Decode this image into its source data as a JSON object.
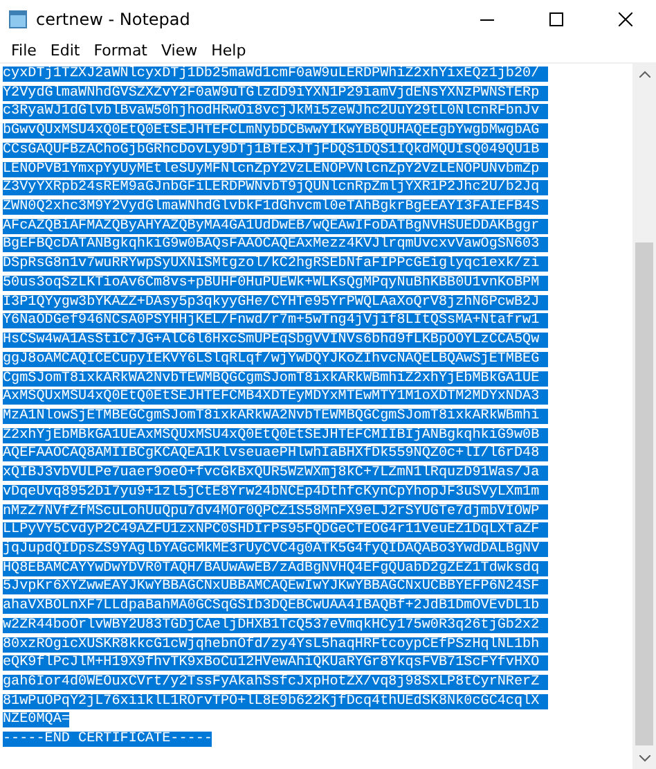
{
  "window": {
    "title": "certnew - Notepad"
  },
  "menu": [
    {
      "label": "File"
    },
    {
      "label": "Edit"
    },
    {
      "label": "Format"
    },
    {
      "label": "View"
    },
    {
      "label": "Help"
    }
  ],
  "document": {
    "selected": true,
    "lines": [
      "cyxDTj1TZXJ2aWNlcyxDTj1Db25maWd1cmF0aW9uLERDPWhiZ2xhYixEQz1jb20/",
      "Y2VydGlmaWNhdGVSZXZvY2F0aW9uTGlzdD9iYXN1P29iamVjdENsYXNzPWNSTERp",
      "c3RyaWJ1dGlvblBvaW50hjhodHRwOi8vcjJkMi5zeWJhc2UuY29tL0NlcnRFbnJv",
      "bGwvQUxMSU4xQ0EtQ0EtSEJHTEFCLmNybDCBwwYIKwYBBQUHAQEEgbYwgbMwgbAG",
      "CCsGAQUFBzAChoGjbGRhcDovLy9DTj1BTExJTjFDQS1DQS1IQkdMQUIsQ049QU1B",
      "LENOPVB1YmxpYyUyMEtleSUyMFNlcnZpY2VzLENOPVNlcnZpY2VzLENOPUNvbmZp",
      "Z3VyYXRpb24sREM9aGJnbGFiLERDPWNvbT9jQUNlcnRpZmljYXR1P2Jhc2U/b2Jq",
      "ZWN0Q2xhc3M9Y2VydGlmaWNhdGlvbkF1dGhvcml0eTAhBgkrBgEEAYI3FAIEFB4S",
      "AFcAZQBiAFMAZQByAHYAZQByMA4GA1UdDwEB/wQEAwIFoDATBgNVHSUEDDAKBggr",
      "BgEFBQcDATANBgkqhkiG9w0BAQsFAAOCAQEAxMezz4KVJlrqmUvcxvVawOgSN603",
      "DSpRsG8n1v7wuRRYwpSyUXNiSMtgzol/kC2hgRSEbNfaFIPPcGEiglyqc1exk/zi",
      "50us3oqSzLKTioAv6Cm8vs+pBUHF0HuPUEWk+WLKsQgMPqyNuBhKBB0U1vnKoBPM",
      "I3P1QYygw3bYKAZZ+DAsy5p3qkyyGHe/CYHTe95YrPWQLAaXoQrV8jzhN6PcwB2J",
      "Y6NaODGef946NCsA0PSYHHjKEL/Fnwd/r7m+5wTng4jVjif8LItQSsMA+Ntafrw1",
      "HsCSw4wA1AsStiC7JG+AlC6l6HxcSmUPEqSbgVVINVs6bhd9fLKBpOOYLzCCA5Qw",
      "ggJ8oAMCAQICECupyIEKVY6LSlqRLqf/wjYwDQYJKoZIhvcNAQELBQAwSjETMBEG",
      "CgmSJomT8ixkARkWA2NvbTEWMBQGCgmSJomT8ixkARkWBmhiZ2xhYjEbMBkGA1UE",
      "AxMSQUxMSU4xQ0EtQ0EtSEJHTEFCMB4XDTEyMDYxMTEwMTY1M1oXDTM2MDYxNDA3",
      "MzA1NlowSjETMBEGCgmSJomT8ixkARkWA2NvbTEWMBQGCgmSJomT8ixkARkWBmhi",
      "Z2xhYjEbMBkGA1UEAxMSQUxMSU4xQ0EtQ0EtSEJHTEFCMIIBIjANBgkqhkiG9w0B",
      "AQEFAAOCAQ8AMIIBCgKCAQEA1klvseuaePHlwhIaBHXfDk559NQZ0c+lI/l6rD48",
      "xQIBJ3vbVULPe7uaer9oeO+fvcGkBxQUR5WzWXmj8kC+7LZmN1lRquzD91Was/Ja",
      "vDqeUvq8952Di7yu9+1zl5jCtE8Yrw24bNCEp4DthfcKynCpYhopJF3uSVyLXm1m",
      "nMzZ7NVfZfMScuLohUuQpu7dv4MOr0QPCZ1S58MnFX9eLJ2rSYUGTe7djmbVIOWP",
      "LLPyVY5CvdyP2C49AZFU1zxNPC0SHDIrPs95FQDGeCTEOG4r11VeuEZ1DqLXTaZF",
      "jqJupdQIDpsZS9YAglbYAGcMkME3rUyCVC4g0ATK5G4fyQIDAQABo3YwdDALBgNV",
      "HQ8EBAMCAYYwDwYDVR0TAQH/BAUwAwEB/zAdBgNVHQ4EFgQUabD2gZEZ1Tdwksdq",
      "5JvpKr6XYZwwEAYJKwYBBAGCNxUBBAMCAQEwIwYJKwYBBAGCNxUCBBYEFP6N24SF",
      "ahaVXBOLnXF7LLdpaBahMA0GCSqGSIb3DQEBCwUAA4IBAQBf+2JdB1DmOVEvDL1b",
      "w2ZR44boOrlvWBY2U83TGDjCAeljDHXB1TcQ537eVmqkHCy175w0R3q26tjGb2x2",
      "80xzROgicXUSKR8kkcG1cWjqhebnOfd/zy4YsL5haqHRFtcoypCEfPSzHqlNL1bh",
      "eQK9flPcJlM+H19X9fhvTK9xBoCu12HVewAhiQKUaRYGr8YkqsFVB71ScFYfvHXO",
      "gah6Ior4d0WEOuxCVrt/y2TssFyAkahSsfcJxpHotZX/vq8j98SxLP8tCyrNRerZ",
      "81wPuOPqY2jL76xiiklL1ROrvTPO+lL8E9b622KjfDcq4thUEdSK8Nk0cGC4cqlX",
      "NZE0MQA=",
      "-----END CERTIFICATE-----"
    ]
  }
}
